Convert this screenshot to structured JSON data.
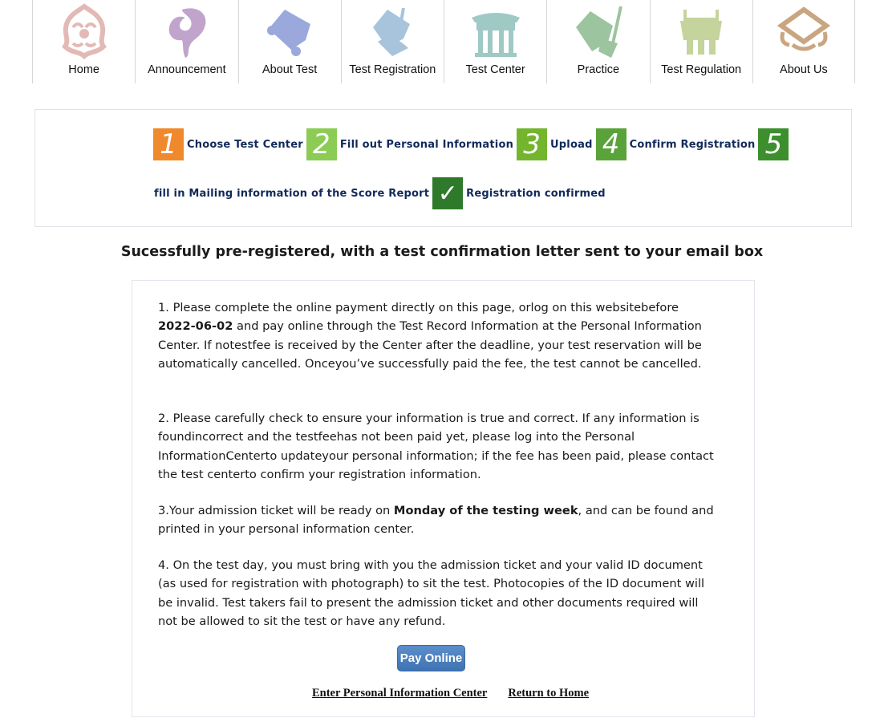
{
  "nav": {
    "items": [
      {
        "label": "Home",
        "icon": "ornament-icon",
        "color": "#e3b9b5"
      },
      {
        "label": "Announcement",
        "icon": "cloud-swirl-icon",
        "color": "#c0a4cc"
      },
      {
        "label": "About Test",
        "icon": "scroll-icon",
        "color": "#9aa8dc"
      },
      {
        "label": "Test Registration",
        "icon": "scroll-brush-icon",
        "color": "#a7c4dc"
      },
      {
        "label": "Test Center",
        "icon": "pavilion-icon",
        "color": "#9ec9c5"
      },
      {
        "label": "Practice",
        "icon": "scroll-pen-icon",
        "color": "#9cc49e"
      },
      {
        "label": "Test Regulation",
        "icon": "bronze-vessel-icon",
        "color": "#c5d49c"
      },
      {
        "label": "About Us",
        "icon": "seal-box-icon",
        "color": "#c9a681"
      }
    ]
  },
  "steps": {
    "items": [
      {
        "number": "1",
        "label": "Choose Test Center",
        "color": "#f0892b"
      },
      {
        "number": "2",
        "label": "Fill out Personal Information",
        "color": "#8ccc55"
      },
      {
        "number": "3",
        "label": "Upload",
        "color": "#74b52e"
      },
      {
        "number": "4",
        "label": "Confirm Registration",
        "color": "#5aa33a"
      },
      {
        "number": "5",
        "label": "fill in Mailing information of the Score Report",
        "color": "#3d8f2e"
      },
      {
        "number": "✓",
        "label": "Registration confirmed",
        "color": "#2e7a2a"
      }
    ]
  },
  "headline": "Sucessfully pre-registered, with a test confirmation letter sent to your email box",
  "notice": {
    "p1_a": "1. Please complete the online payment directly on this page, orlog on this websitebefore ",
    "p1_date": "2022-06-02",
    "p1_b": " and pay online through the Test Record Information at the Personal Information Center. If notestfee is received by the Center after the deadline, your test reservation will be automatically cancelled. Onceyou’ve successfully paid the fee, the test cannot be cancelled.",
    "p2": "2. Please carefully check to ensure your information is true and correct. If any information is foundincorrect and the testfeehas not been paid yet, please log into the Personal InformationCenterto updateyour personal information; if the fee has been paid, please contact the test centerto confirm your registration information.",
    "p3_a": "3.Your admission ticket will be ready on ",
    "p3_bold": "Monday of the testing week",
    "p3_b": ", and can be found and printed in your personal information center.",
    "p4": "4. On the test day, you must bring with you the admission ticket and your valid ID document (as used for registration with photograph) to sit the test. Photocopies of the ID document will be invalid. Test takers fail to present the admission ticket and other documents required will not be allowed to sit the test or have any refund."
  },
  "actions": {
    "pay_label": "Pay Online",
    "enter_center_label": "Enter Personal Information Center",
    "return_home_label": "Return to Home"
  }
}
